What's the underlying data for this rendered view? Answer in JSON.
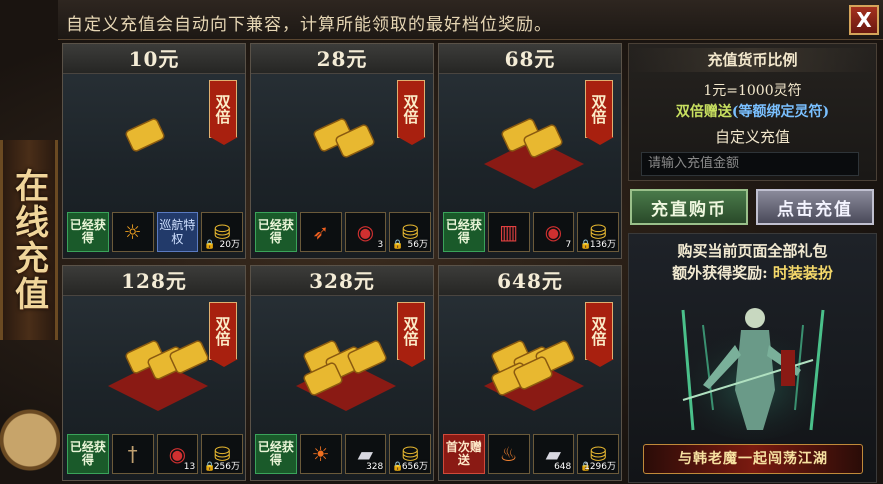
{
  "topbar": {
    "notice": "自定义充值会自动向下兼容，计算所能领取的最好档位奖励。",
    "close_label": "X"
  },
  "side_banner": {
    "text": "在线充值"
  },
  "cards": [
    {
      "price": "10元",
      "badge": "双倍",
      "items": [
        {
          "kind": "obtained",
          "label": "已经获得"
        },
        {
          "kind": "icon",
          "icon": "lion-head-icon"
        },
        {
          "kind": "privilege",
          "label": "巡航特权"
        },
        {
          "kind": "gold",
          "icon": "gold-ingot-icon",
          "count": "20万",
          "locked": true
        }
      ]
    },
    {
      "price": "28元",
      "badge": "双倍",
      "items": [
        {
          "kind": "obtained",
          "label": "已经获得"
        },
        {
          "kind": "icon",
          "icon": "fire-streak-icon"
        },
        {
          "kind": "icon",
          "icon": "red-swirl-icon",
          "count": "3"
        },
        {
          "kind": "gold",
          "icon": "gold-ingot-icon",
          "count": "56万",
          "locked": true
        }
      ]
    },
    {
      "price": "68元",
      "badge": "双倍",
      "items": [
        {
          "kind": "obtained",
          "label": "已经获得"
        },
        {
          "kind": "icon",
          "icon": "red-scroll-icon"
        },
        {
          "kind": "icon",
          "icon": "red-swirl-icon",
          "count": "7"
        },
        {
          "kind": "gold",
          "icon": "gold-ingot-icon",
          "count": "136万",
          "locked": true
        }
      ]
    },
    {
      "price": "128元",
      "badge": "双倍",
      "items": [
        {
          "kind": "obtained",
          "label": "已经获得"
        },
        {
          "kind": "icon",
          "icon": "dagger-icon"
        },
        {
          "kind": "icon",
          "icon": "red-swirl-icon",
          "count": "13"
        },
        {
          "kind": "gold",
          "icon": "gold-ingot-icon",
          "count": "256万",
          "locked": true
        }
      ]
    },
    {
      "price": "328元",
      "badge": "双倍",
      "items": [
        {
          "kind": "obtained",
          "label": "已经获得"
        },
        {
          "kind": "icon",
          "icon": "fire-orb-icon"
        },
        {
          "kind": "icon",
          "icon": "silver-ingot-icon",
          "count": "328"
        },
        {
          "kind": "gold",
          "icon": "gold-ingot-icon",
          "count": "656万",
          "locked": true
        }
      ]
    },
    {
      "price": "648元",
      "badge": "双倍",
      "items": [
        {
          "kind": "first",
          "label": "首次赠送"
        },
        {
          "kind": "icon",
          "icon": "flame-sword-icon"
        },
        {
          "kind": "icon",
          "icon": "silver-ingot-icon",
          "count": "648"
        },
        {
          "kind": "gold",
          "icon": "gold-ingot-icon",
          "count": "1296万",
          "locked": true
        }
      ]
    }
  ],
  "rate": {
    "title": "充值货币比例",
    "ratio": "1元=1000灵符",
    "bonus_prefix": "双倍赠送",
    "bonus_suffix": "(等额绑定灵符)",
    "custom_label": "自定义充值",
    "input_placeholder": "请输入充值金额"
  },
  "buttons": {
    "buy": "充直购币",
    "recharge": "点击充值"
  },
  "promo": {
    "line1": "购买当前页面全部礼包",
    "line2_prefix": "额外获得奖励: ",
    "line2_highlight": "时装装扮",
    "slogan": "与韩老魔一起闯荡江湖"
  },
  "colors": {
    "accent_gold": "#f4d86a",
    "badge_red": "#a8200f",
    "obtained_green": "#1a5a2a",
    "bonus_green": "#c8e060",
    "bonus_blue": "#7ac0ff"
  }
}
